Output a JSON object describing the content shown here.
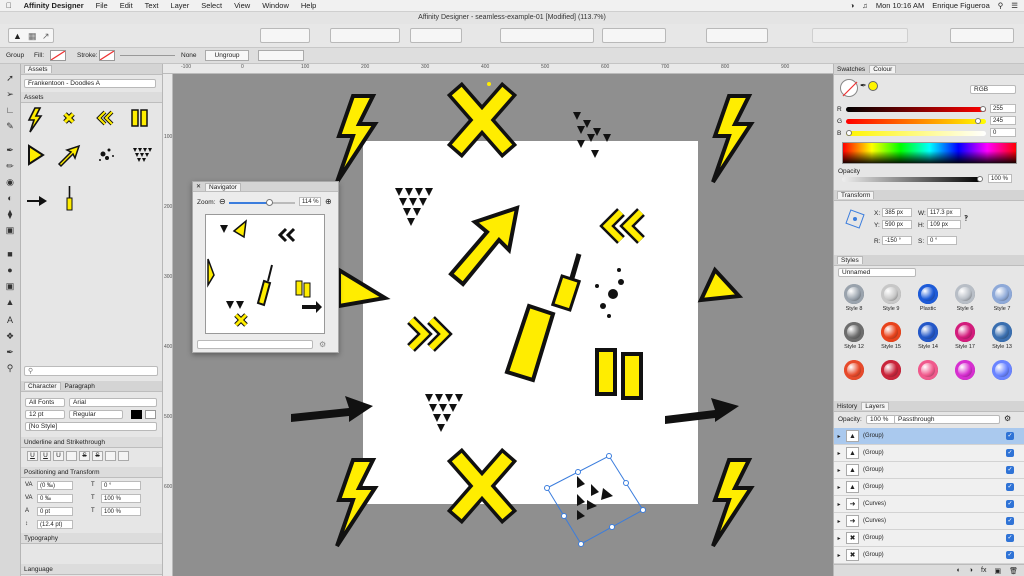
{
  "menubar": {
    "app": "Affinity Designer",
    "items": [
      "File",
      "Edit",
      "Text",
      "Layer",
      "Select",
      "View",
      "Window",
      "Help"
    ],
    "clock": "Mon 10:16 AM",
    "user": "Enrique Figueroa"
  },
  "window": {
    "title": "Affinity Designer - seamless-example-01 [Modified] (113.7%)"
  },
  "context": {
    "group_label": "Group",
    "fill_label": "Fill:",
    "stroke_label": "Stroke:",
    "stroke_value": "None",
    "ungroup_label": "Ungroup"
  },
  "assets": {
    "tab": "Assets",
    "dropdown": "Frankentoon - Doodles A",
    "section": "Assets"
  },
  "search": {
    "placeholder": ""
  },
  "character": {
    "tabs": [
      "Character",
      "Paragraph"
    ],
    "font_collection": "All Fonts",
    "font": "Arial",
    "size": "12 pt",
    "weight": "Regular",
    "style": "[No Style]",
    "underline_section": "Underline and Strikethrough",
    "positioning_section": "Positioning and Transform",
    "kerning": "(0 ‰)",
    "tracking": "0 ‰",
    "baseline": "0 pt",
    "leading": "(12.4 pt)",
    "rotation": "0 °",
    "hscale": "100 %",
    "vscale": "100 %",
    "typography_section": "Typography",
    "language_section": "Language"
  },
  "ruler": {
    "top": [
      "-100",
      "0",
      "100",
      "200",
      "300",
      "400",
      "500",
      "600",
      "700",
      "800",
      "900"
    ],
    "left": [
      "100",
      "200",
      "300",
      "400",
      "500",
      "600"
    ]
  },
  "navigator": {
    "title": "Navigator",
    "zoom_label": "Zoom:",
    "zoom_value": "114 %",
    "zoom_fraction": 0.6
  },
  "colour": {
    "tabs": [
      "Swatches",
      "Colour"
    ],
    "mode": "RGB",
    "r": "255",
    "g": "245",
    "b": "0",
    "r_frac": 1.0,
    "g_frac": 0.96,
    "b_frac": 0.0,
    "opacity_label": "Opacity",
    "opacity": "100 %",
    "fill_color": "#fff500"
  },
  "transform": {
    "tab": "Transform",
    "x": "385 px",
    "y": "590 px",
    "w": "117.3 px",
    "h": "109 px",
    "r": "-150 °",
    "s": "0 °"
  },
  "styles": {
    "tab": "Styles",
    "category": "Unnamed",
    "items": [
      "Style 8",
      "Style 9",
      "Plastic",
      "Style 6",
      "Style 7",
      "Style 12",
      "Style 15",
      "Style 14",
      "Style 17",
      "Style 13",
      "",
      "",
      "",
      "",
      ""
    ],
    "colors": [
      "#9aa3ad",
      "#c7c7c7",
      "#1d5bd8",
      "#b8bec6",
      "#8ea9d8",
      "#6d6d6d",
      "#e8431c",
      "#2458c8",
      "#d31c7c",
      "#3a6fb0",
      "#e74a2b",
      "#c9253b",
      "#f05a8c",
      "#d62fd0",
      "#6a84ff"
    ]
  },
  "layers": {
    "tabs": [
      "History",
      "Layers"
    ],
    "opacity_label": "Opacity:",
    "opacity": "100 %",
    "blend": "Passthrough",
    "items": [
      {
        "name": "(Group)",
        "thumb": "triangles"
      },
      {
        "name": "(Group)",
        "thumb": "triangles"
      },
      {
        "name": "(Group)",
        "thumb": "triangles"
      },
      {
        "name": "(Group)",
        "thumb": "triangles"
      },
      {
        "name": "(Curves)",
        "thumb": "arrow"
      },
      {
        "name": "(Curves)",
        "thumb": "arrow"
      },
      {
        "name": "(Group)",
        "thumb": "x"
      },
      {
        "name": "(Group)",
        "thumb": "x"
      }
    ]
  }
}
